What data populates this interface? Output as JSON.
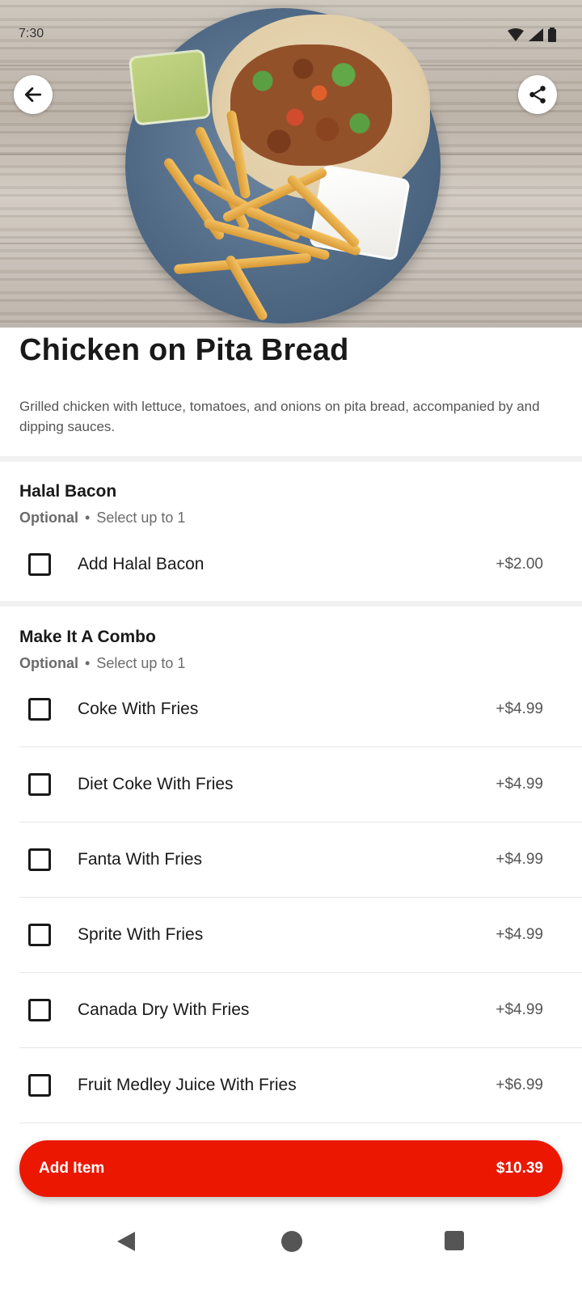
{
  "status_bar": {
    "time": "7:30"
  },
  "item": {
    "title": "Chicken on Pita Bread",
    "description": "Grilled chicken with lettuce, tomatoes, and onions on pita bread, accompanied by and dipping sauces."
  },
  "sections": [
    {
      "title": "Halal Bacon",
      "optional": "Optional",
      "dot": "•",
      "select": "Select up to 1",
      "options": [
        {
          "label": "Add Halal Bacon",
          "price": "+$2.00"
        }
      ]
    },
    {
      "title": "Make It A Combo",
      "optional": "Optional",
      "dot": "•",
      "select": "Select up to 1",
      "options": [
        {
          "label": "Coke With Fries",
          "price": "+$4.99"
        },
        {
          "label": "Diet Coke With Fries",
          "price": "+$4.99"
        },
        {
          "label": "Fanta With Fries",
          "price": "+$4.99"
        },
        {
          "label": "Sprite With Fries",
          "price": "+$4.99"
        },
        {
          "label": "Canada Dry With Fries",
          "price": "+$4.99"
        },
        {
          "label": "Fruit Medley Juice With Fries",
          "price": "+$6.99"
        }
      ]
    }
  ],
  "add_button": {
    "label": "Add Item",
    "price": "$10.39"
  },
  "colors": {
    "accent": "#eb1700",
    "text": "#191919",
    "muted": "#6b6b6b"
  },
  "icons": [
    "back-arrow-icon",
    "share-icon",
    "wifi-icon",
    "signal-icon",
    "battery-icon",
    "checkbox-icon",
    "nav-back-icon",
    "nav-home-icon",
    "nav-recents-icon"
  ]
}
